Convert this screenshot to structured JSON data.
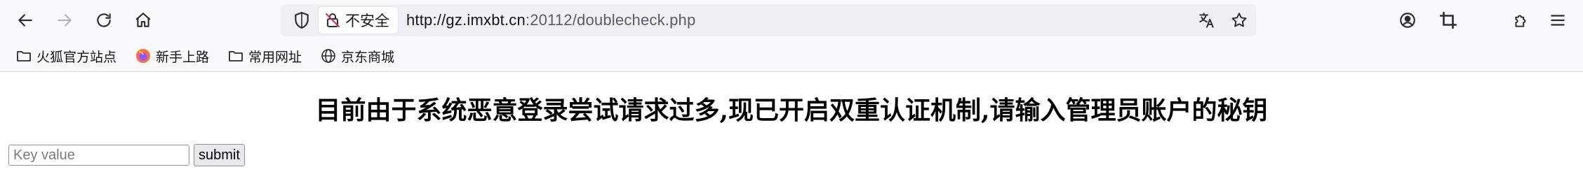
{
  "browser": {
    "security_label": "不安全",
    "url_host": "http://gz.imxbt.cn",
    "url_port": ":20112",
    "url_path": "/doublecheck.php"
  },
  "bookmarks": [
    {
      "label": "火狐官方站点",
      "icon": "folder-icon"
    },
    {
      "label": "新手上路",
      "icon": "firefox-icon"
    },
    {
      "label": "常用网址",
      "icon": "folder-icon"
    },
    {
      "label": "京东商城",
      "icon": "globe-icon"
    }
  ],
  "page": {
    "heading": "目前由于系统恶意登录尝试请求过多,现已开启双重认证机制,请输入管理员账户的秘钥",
    "key_placeholder": "Key value",
    "submit_label": "submit"
  }
}
